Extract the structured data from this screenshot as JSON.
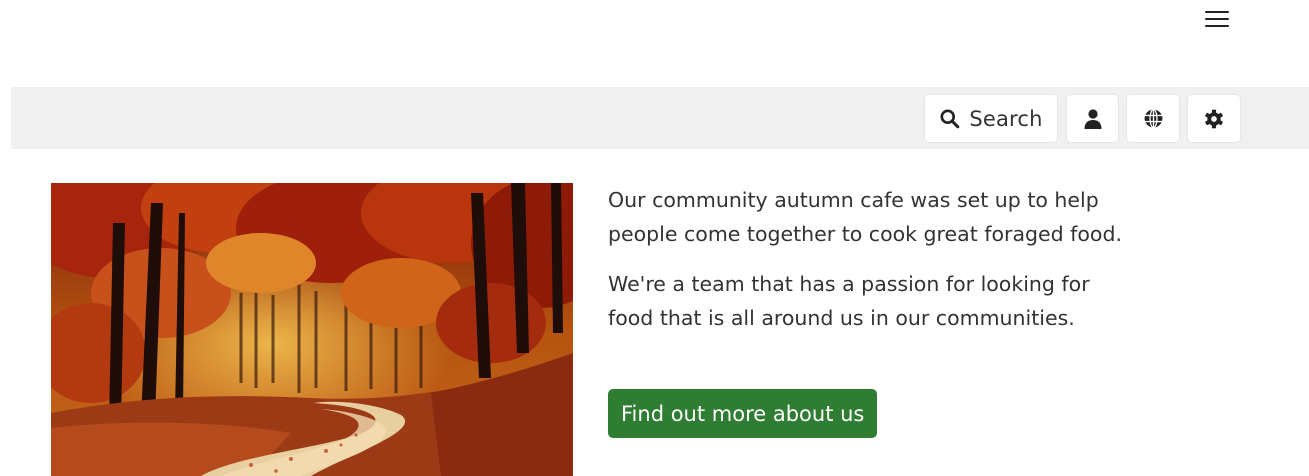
{
  "header": {
    "menu_icon": "hamburger-menu-icon"
  },
  "toolbar": {
    "search_label": "Search",
    "icons": {
      "search": "search-icon",
      "account": "user-icon",
      "language": "globe-icon",
      "settings": "gear-icon"
    }
  },
  "main": {
    "paragraphs": [
      "Our community autumn cafe was set up to help people come together to cook great foraged food.",
      "We're a team that has a passion for looking for food that is all around us in our communities."
    ],
    "cta_label": "Find out more about us"
  },
  "colors": {
    "toolbar_bg": "#f0f0f0",
    "cta_bg": "#2e7d32",
    "cta_text": "#ffffff",
    "text": "#333333"
  }
}
